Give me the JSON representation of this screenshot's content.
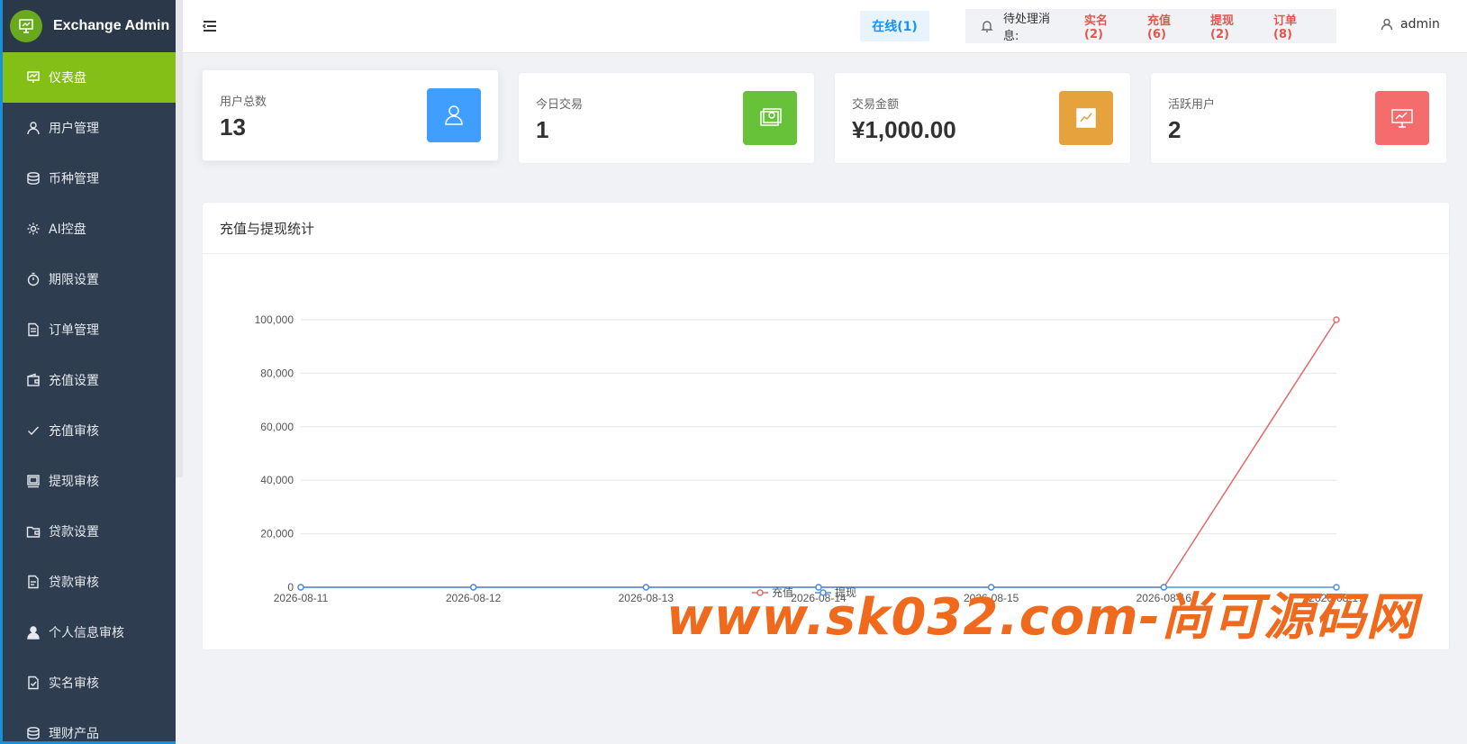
{
  "app": {
    "title": "Exchange Admin",
    "brand_color": "#6aa91c"
  },
  "sidebar": {
    "items": [
      {
        "label": "仪表盘",
        "icon": "dashboard-icon",
        "active": true
      },
      {
        "label": "用户管理",
        "icon": "user-icon"
      },
      {
        "label": "币种管理",
        "icon": "coins-icon"
      },
      {
        "label": "AI控盘",
        "icon": "gear-icon"
      },
      {
        "label": "期限设置",
        "icon": "timer-icon"
      },
      {
        "label": "订单管理",
        "icon": "document-icon"
      },
      {
        "label": "充值设置",
        "icon": "wallet-icon"
      },
      {
        "label": "充值审核",
        "icon": "check-icon"
      },
      {
        "label": "提现审核",
        "icon": "withdraw-icon"
      },
      {
        "label": "贷款设置",
        "icon": "folder-icon"
      },
      {
        "label": "贷款审核",
        "icon": "file-icon"
      },
      {
        "label": "个人信息审核",
        "icon": "person-icon"
      },
      {
        "label": "实名审核",
        "icon": "verified-file-icon"
      },
      {
        "label": "理财产品",
        "icon": "coins-icon"
      }
    ]
  },
  "header": {
    "online": "在线(1)",
    "notice_label": "待处理消息:",
    "notices": [
      "实名(2)",
      "充值(6)",
      "提现(2)",
      "订单(8)"
    ],
    "user": "admin"
  },
  "stats": [
    {
      "label": "用户总数",
      "value": "13",
      "icon": "user-icon",
      "color": "#409eff"
    },
    {
      "label": "今日交易",
      "value": "1",
      "icon": "money-icon",
      "color": "#67c23a"
    },
    {
      "label": "交易金额",
      "value": "¥1,000.00",
      "icon": "trend-icon",
      "color": "#e6a23c"
    },
    {
      "label": "活跃用户",
      "value": "2",
      "icon": "presentation-icon",
      "color": "#f56c6c"
    }
  ],
  "chart": {
    "title": "充值与提现统计"
  },
  "chart_data": {
    "type": "line",
    "categories": [
      "2026-08-11",
      "2026-08-12",
      "2026-08-13",
      "2026-08-14",
      "2026-08-15",
      "2026-08-16",
      "2026-08-17"
    ],
    "series": [
      {
        "name": "充值",
        "values": [
          0,
          0,
          0,
          0,
          0,
          0,
          100000
        ],
        "color": "#e06a6a"
      },
      {
        "name": "提现",
        "values": [
          0,
          0,
          0,
          0,
          0,
          0,
          0
        ],
        "color": "#4a90e2"
      }
    ],
    "yticks": [
      "0",
      "20,000",
      "40,000",
      "60,000",
      "80,000",
      "100,000"
    ],
    "ylim": [
      0,
      100000
    ],
    "grid": true,
    "legend": "bottom-center"
  },
  "watermark": "www.sk032.com-尚可源码网"
}
